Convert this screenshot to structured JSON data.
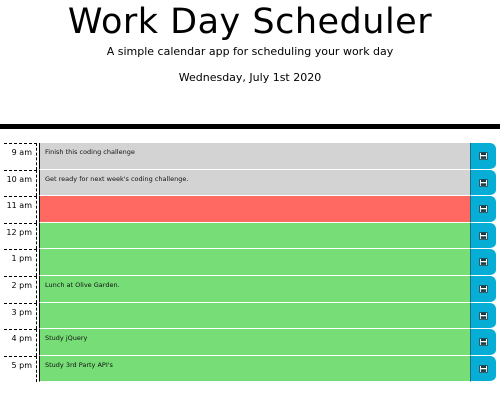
{
  "header": {
    "title": "Work Day Scheduler",
    "lead": "A simple calendar app for scheduling your work day",
    "current_day": "Wednesday, July 1st 2020"
  },
  "colors": {
    "past": "#d3d3d3",
    "present": "#ff6961",
    "future": "#77dd77",
    "save_button": "#06aed5"
  },
  "time_blocks": [
    {
      "hour": "9 am",
      "text": "Finish this coding challenge",
      "state": "past"
    },
    {
      "hour": "10 am",
      "text": "Get ready for next week's coding challenge.",
      "state": "past"
    },
    {
      "hour": "11 am",
      "text": "",
      "state": "present"
    },
    {
      "hour": "12 pm",
      "text": "",
      "state": "future"
    },
    {
      "hour": "1 pm",
      "text": "",
      "state": "future"
    },
    {
      "hour": "2 pm",
      "text": "Lunch at Olive Garden.",
      "state": "future"
    },
    {
      "hour": "3 pm",
      "text": "",
      "state": "future"
    },
    {
      "hour": "4 pm",
      "text": "Study jQuery",
      "state": "future"
    },
    {
      "hour": "5 pm",
      "text": "Study 3rd Party API's",
      "state": "future"
    }
  ],
  "save_icon": "floppy-disk-icon"
}
